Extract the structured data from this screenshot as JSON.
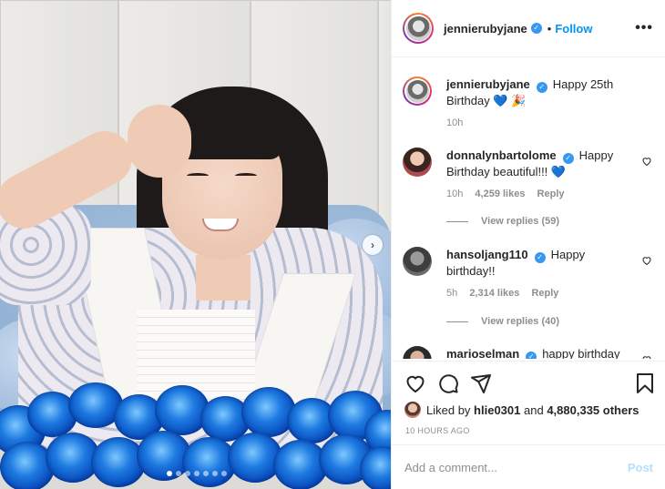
{
  "post": {
    "username": "jennierubyjane",
    "verified": true,
    "separator": "•",
    "follow_label": "Follow",
    "more_label": "•••",
    "carousel": {
      "total_slides": 7,
      "active_index": 0,
      "next_icon": "chevron-right-icon",
      "next_glyph": "›"
    }
  },
  "caption": {
    "username": "jennierubyjane",
    "text": "Happy 25th Birthday",
    "emoji": "💙 🎉",
    "time": "10h"
  },
  "comments": [
    {
      "username": "donnalynbartolome",
      "text": "Happy Birthday beautiful!!!",
      "emoji": "💙",
      "time": "10h",
      "likes": "4,259 likes",
      "reply_label": "Reply",
      "view_replies": "View replies (59)"
    },
    {
      "username": "hansoljang110",
      "text": "Happy birthday!!",
      "emoji": "",
      "time": "5h",
      "likes": "2,314 likes",
      "reply_label": "Reply",
      "view_replies": "View replies (40)"
    },
    {
      "username": "marioselman",
      "text": "happy birthday",
      "emoji": ""
    }
  ],
  "likes": {
    "prefix": "Liked by",
    "user": "hlie0301",
    "joiner": "and",
    "others": "4,880,335 others"
  },
  "time_ago": "10 HOURS AGO",
  "add_comment": {
    "placeholder": "Add a comment...",
    "post_label": "Post"
  },
  "colors": {
    "follow": "#0095f6",
    "verified": "#3897f0",
    "post_disabled": "#b2dffc",
    "muted": "#8e8e8e"
  }
}
